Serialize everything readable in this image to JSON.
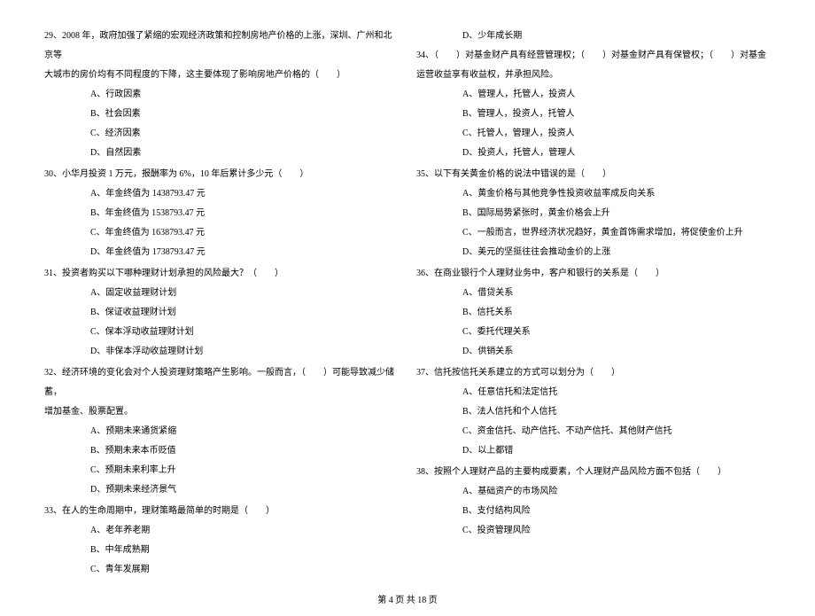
{
  "left": {
    "q29": {
      "line1": "29、2008 年，政府加强了紧缩的宏观经济政策和控制房地产价格的上涨，深圳、广州和北京等",
      "line2": "大城市的房价均有不同程度的下降，这主要体现了影响房地产价格的（　　）",
      "a": "A、行政因素",
      "b": "B、社会因素",
      "c": "C、经济因素",
      "d": "D、自然因素"
    },
    "q30": {
      "text": "30、小华月投资 1 万元，报酬率为 6%，10 年后累计多少元（　　）",
      "a": "A、年金终值为 1438793.47 元",
      "b": "B、年金终值为 1538793.47 元",
      "c": "C、年金终值为 1638793.47 元",
      "d": "D、年金终值为 1738793.47 元"
    },
    "q31": {
      "text": "31、投资者购买以下哪种理财计划承担的风险最大？（　　）",
      "a": "A、固定收益理财计划",
      "b": "B、保证收益理财计划",
      "c": "C、保本浮动收益理财计划",
      "d": "D、非保本浮动收益理财计划"
    },
    "q32": {
      "line1": "32、经济环境的变化会对个人投资理财策略产生影响。一般而言，（　　）可能导致减少储蓄，",
      "line2": "增加基金、股票配置。",
      "a": "A、预期未来通货紧缩",
      "b": "B、预期未来本币贬值",
      "c": "C、预期未来利率上升",
      "d": "D、预期未来经济景气"
    },
    "q33": {
      "text": "33、在人的生命周期中，理财策略最简单的时期是（　　）",
      "a": "A、老年养老期",
      "b": "B、中年成熟期",
      "c": "C、青年发展期"
    }
  },
  "right": {
    "q33d": "D、少年成长期",
    "q34": {
      "line1": "34、（　　）对基金财产具有经营管理权；（　　）对基金财产具有保管权；（　　）对基金",
      "line2": "运营收益享有收益权，并承担风险。",
      "a": "A、管理人，托管人，投资人",
      "b": "B、管理人，投资人，托管人",
      "c": "C、托管人，管理人，投资人",
      "d": "D、投资人，托管人，管理人"
    },
    "q35": {
      "text": "35、以下有关黄金价格的说法中错误的是（　　）",
      "a": "A、黄金价格与其他竞争性投资收益率成反向关系",
      "b": "B、国际局势紧张时，黄金价格会上升",
      "c": "C、一般而言，世界经济状况趋好，黄金首饰需求增加，将促使金价上升",
      "d": "D、美元的坚挺往往会推动金价的上涨"
    },
    "q36": {
      "text": "36、在商业银行个人理财业务中，客户和银行的关系是（　　）",
      "a": "A、借贷关系",
      "b": "B、信托关系",
      "c": "C、委托代理关系",
      "d": "D、供销关系"
    },
    "q37": {
      "text": "37、信托按信托关系建立的方式可以划分为（　　）",
      "a": "A、任意信托和法定信托",
      "b": "B、法人信托和个人信托",
      "c": "C、资金信托、动产信托、不动产信托、其他财产信托",
      "d": "D、以上都错"
    },
    "q38": {
      "text": "38、按照个人理财产品的主要构成要素，个人理财产品风险方面不包括（　　）",
      "a": "A、基础资产的市场风险",
      "b": "B、支付结构风险",
      "c": "C、投资管理风险"
    }
  },
  "footer": "第 4 页 共 18 页"
}
